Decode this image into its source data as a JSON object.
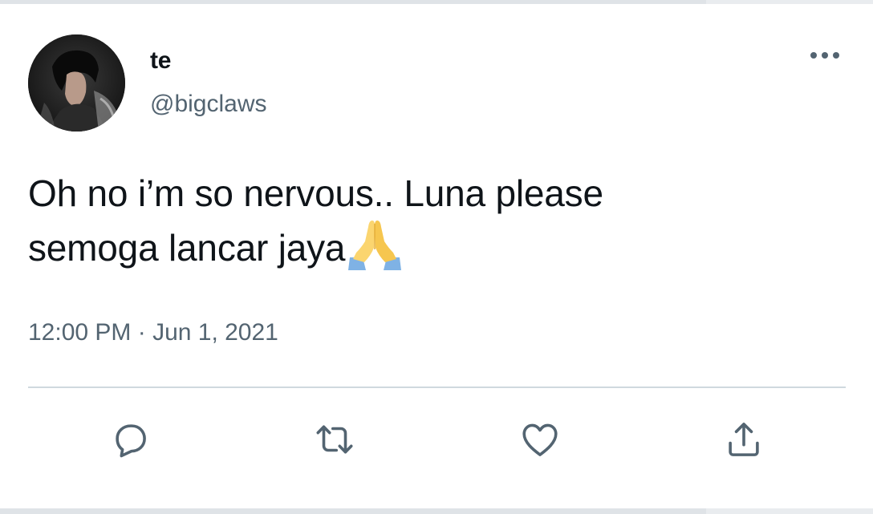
{
  "tweet": {
    "display_name": "te",
    "handle": "@bigclaws",
    "text_line1": "Oh no i’m so nervous.. Luna please",
    "text_line2": "semoga lancar jaya",
    "emoji": "folded-hands-emoji",
    "timestamp": "12:00 PM · Jun 1, 2021"
  },
  "icons": {
    "more": "more-options-icon",
    "reply": "reply-icon",
    "retweet": "retweet-icon",
    "like": "like-icon",
    "share": "share-icon"
  },
  "colors": {
    "text": "#0f1419",
    "secondary": "#536471",
    "divider": "#cfd9de",
    "border": "#e9ecef"
  }
}
